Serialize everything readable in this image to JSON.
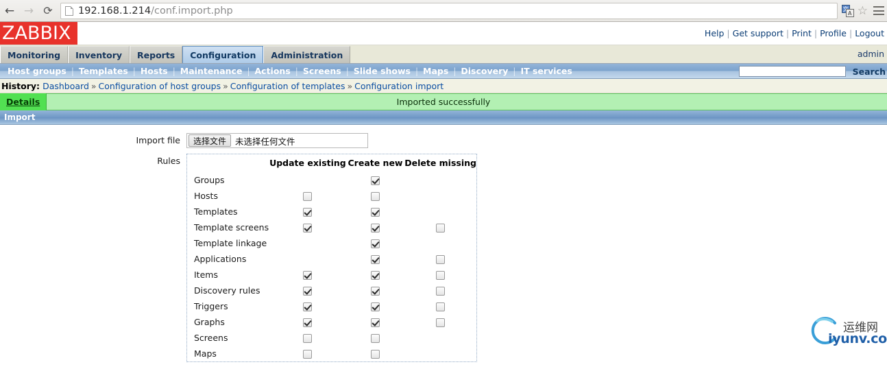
{
  "browser": {
    "back_icon": "back-arrow-icon",
    "forward_icon": "forward-arrow-icon",
    "reload_icon": "reload-icon",
    "url_host": "192.168.1.214",
    "url_path": "/conf.import.php",
    "url_full": "192.168.1.214/conf.import.php",
    "translate_icon": "translate-icon",
    "translate_glyph_1": "文",
    "translate_glyph_2": "A",
    "bookmark_icon": "star-icon",
    "menu_icon": "hamburger-menu-icon"
  },
  "zabbix": {
    "logo": "ZABBIX",
    "logo_color": "#e8322b",
    "user": "admin",
    "top_links": [
      "Help",
      "Get support",
      "Print",
      "Profile",
      "Logout"
    ],
    "main_tabs": [
      {
        "label": "Monitoring",
        "active": false
      },
      {
        "label": "Inventory",
        "active": false
      },
      {
        "label": "Reports",
        "active": false
      },
      {
        "label": "Configuration",
        "active": true
      },
      {
        "label": "Administration",
        "active": false
      }
    ],
    "sub_menu": [
      "Host groups",
      "Templates",
      "Hosts",
      "Maintenance",
      "Actions",
      "Screens",
      "Slide shows",
      "Maps",
      "Discovery",
      "IT services"
    ],
    "search": {
      "value": "",
      "placeholder": "",
      "label": "Search"
    },
    "history": {
      "label": "History:",
      "separator": "»",
      "items": [
        "Dashboard",
        "Configuration of host groups",
        "Configuration of templates",
        "Configuration import"
      ]
    },
    "message": {
      "details_label": "Details",
      "text": "Imported successfully",
      "bg_color": "#b3f0b3",
      "accent_color": "#52e052"
    },
    "form": {
      "header": "Import",
      "import_file_label": "Import file",
      "file_button_label": "选择文件",
      "file_name_text": "未选择任何文件",
      "rules_label": "Rules"
    },
    "rules_table": {
      "columns": [
        "",
        "Update existing",
        "Create new",
        "Delete missing"
      ],
      "rows": [
        {
          "name": "Groups",
          "update": null,
          "create": true,
          "delete": null
        },
        {
          "name": "Hosts",
          "update": false,
          "create": false,
          "delete": null
        },
        {
          "name": "Templates",
          "update": true,
          "create": true,
          "delete": null
        },
        {
          "name": "Template screens",
          "update": true,
          "create": true,
          "delete": false
        },
        {
          "name": "Template linkage",
          "update": null,
          "create": true,
          "delete": null
        },
        {
          "name": "Applications",
          "update": null,
          "create": true,
          "delete": false
        },
        {
          "name": "Items",
          "update": true,
          "create": true,
          "delete": false
        },
        {
          "name": "Discovery rules",
          "update": true,
          "create": true,
          "delete": false
        },
        {
          "name": "Triggers",
          "update": true,
          "create": true,
          "delete": false
        },
        {
          "name": "Graphs",
          "update": true,
          "create": true,
          "delete": false
        },
        {
          "name": "Screens",
          "update": false,
          "create": false,
          "delete": null
        },
        {
          "name": "Maps",
          "update": false,
          "create": false,
          "delete": null
        }
      ]
    }
  },
  "watermark": {
    "text_cn": "运维网",
    "text_en": "iyunv.com",
    "color": "#1f5fa8"
  }
}
